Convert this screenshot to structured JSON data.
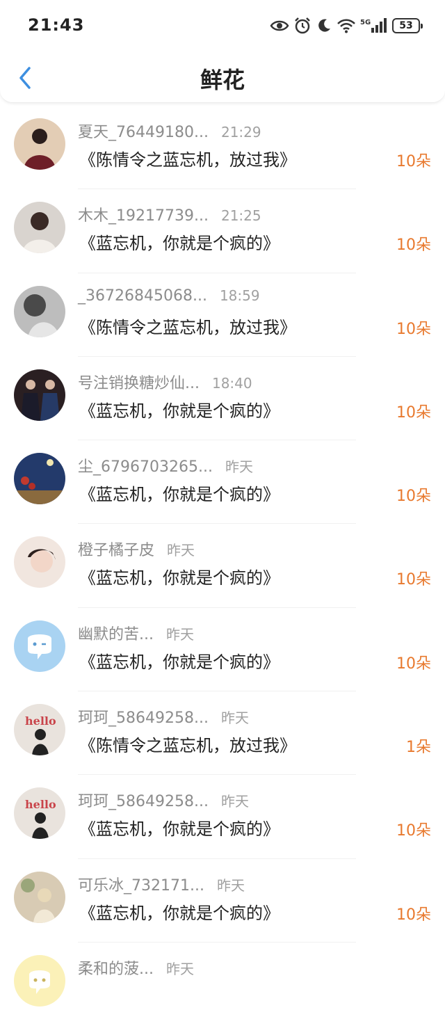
{
  "status": {
    "time": "21:43",
    "battery": "53",
    "network": "5G"
  },
  "header": {
    "title": "鲜花"
  },
  "list": [
    {
      "name": "夏天_76449180...",
      "time": "21:29",
      "gift": "《陈情令之蓝忘机，放过我》",
      "amount": "10朵",
      "avatar": "photo-avatar"
    },
    {
      "name": "木木_19217739...",
      "time": "21:25",
      "gift": "《蓝忘机，你就是个疯的》",
      "amount": "10朵",
      "avatar": "photo-avatar"
    },
    {
      "name": "_36726845068...",
      "time": "18:59",
      "gift": "《陈情令之蓝忘机，放过我》",
      "amount": "10朵",
      "avatar": "photo-avatar"
    },
    {
      "name": "号注销换糖炒仙...",
      "time": "18:40",
      "gift": "《蓝忘机，你就是个疯的》",
      "amount": "10朵",
      "avatar": "photo-avatar"
    },
    {
      "name": "尘_6796703265...",
      "time": "昨天",
      "gift": "《蓝忘机，你就是个疯的》",
      "amount": "10朵",
      "avatar": "photo-avatar"
    },
    {
      "name": "橙子橘子皮",
      "time": "昨天",
      "gift": "《蓝忘机，你就是个疯的》",
      "amount": "10朵",
      "avatar": "photo-avatar"
    },
    {
      "name": "幽默的苦...",
      "time": "昨天",
      "gift": "《蓝忘机，你就是个疯的》",
      "amount": "10朵",
      "avatar": "default-chat-avatar"
    },
    {
      "name": "珂珂_58649258...",
      "time": "昨天",
      "gift": "《陈情令之蓝忘机，放过我》",
      "amount": "1朵",
      "avatar": "photo-avatar"
    },
    {
      "name": "珂珂_58649258...",
      "time": "昨天",
      "gift": "《蓝忘机，你就是个疯的》",
      "amount": "10朵",
      "avatar": "photo-avatar"
    },
    {
      "name": "可乐冰_732171...",
      "time": "昨天",
      "gift": "《蓝忘机，你就是个疯的》",
      "amount": "10朵",
      "avatar": "photo-avatar"
    },
    {
      "name": "柔和的菠...",
      "time": "昨天",
      "gift": "",
      "amount": "",
      "avatar": "default-chat-avatar"
    }
  ],
  "colors": {
    "accent_blue": "#3d8fe0",
    "amount_orange": "#e8792e",
    "name_gray": "#8c8c8c"
  }
}
